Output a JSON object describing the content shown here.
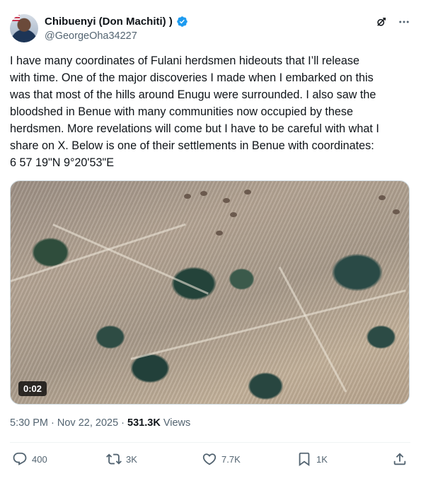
{
  "author": {
    "display_name": "Chibuenyi (Don Machiti) )",
    "handle": "@GeorgeOha34227",
    "verified_icon": "verified-badge-icon"
  },
  "header_icons": [
    "grok-icon",
    "more-icon"
  ],
  "tweet": {
    "lines": [
      "I have many coordinates of Fulani herdsmen hideouts that I’ll release",
      "with time. One of the major discoveries I made when I embarked on this",
      "was that most of the hills around Enugu were surrounded. I also saw the",
      "bloodshed in Benue with many communities now occupied by these",
      "herdsmen. More revelations will come but I have to be careful with what I",
      "share on X. Below is one of their settlements in Benue with coordinates:",
      "6 57 19\"N 9°20'53\"E"
    ]
  },
  "media": {
    "duration": "0:02"
  },
  "meta": {
    "time": "5:30 PM",
    "separator": " · ",
    "date": "Nov 22, 2025",
    "views_count": "531.3K",
    "views_label": " Views"
  },
  "actions": {
    "replies": "400",
    "reposts": "3K",
    "likes": "7.7K",
    "bookmarks": "1K"
  },
  "colors": {
    "text": "#0f1419",
    "secondary": "#536471",
    "verified": "#1d9bf0",
    "border": "#cfd9de"
  }
}
